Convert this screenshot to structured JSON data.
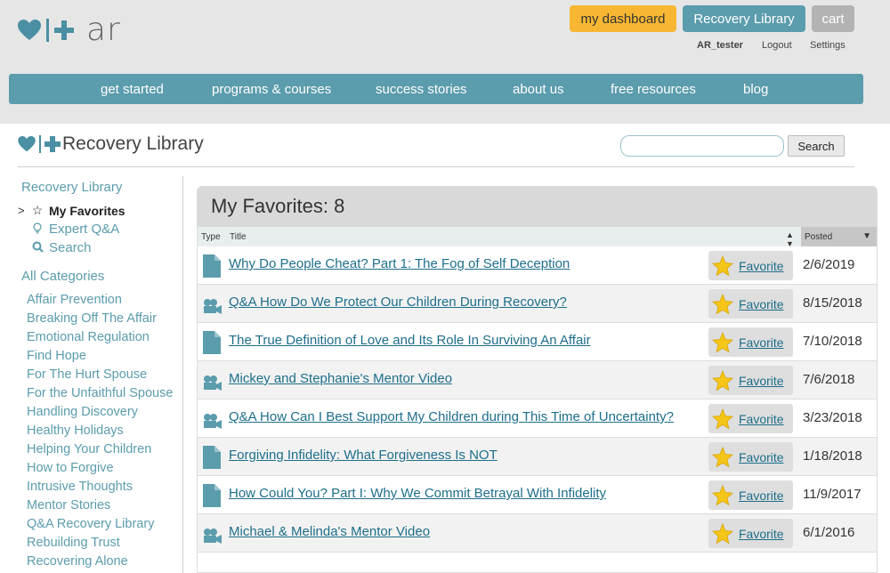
{
  "header": {
    "logo_text": "ar",
    "buttons": {
      "dashboard": "my dashboard",
      "library": "Recovery Library",
      "cart": "cart"
    },
    "user": {
      "name": "AR_tester",
      "logout": "Logout",
      "settings": "Settings"
    },
    "nav": [
      "get started",
      "programs & courses",
      "success stories",
      "about us",
      "free resources",
      "blog"
    ]
  },
  "library": {
    "title": "Recovery Library",
    "search": {
      "placeholder": "",
      "button": "Search"
    }
  },
  "sidebar": {
    "heading": "Recovery Library",
    "items": [
      {
        "label": "My Favorites",
        "icon": "star-icon",
        "active": true
      },
      {
        "label": "Expert Q&A",
        "icon": "lightbulb-icon",
        "active": false
      },
      {
        "label": "Search",
        "icon": "search-icon",
        "active": false
      }
    ],
    "categories_heading": "All Categories",
    "categories": [
      "Affair Prevention",
      "Breaking Off The Affair",
      "Emotional Regulation",
      "Find Hope",
      "For The Hurt Spouse",
      "For the Unfaithful Spouse",
      "Handling Discovery",
      "Healthy Holidays",
      "Helping Your Children",
      "How to Forgive",
      "Intrusive Thoughts",
      "Mentor Stories",
      "Q&A Recovery Library",
      "Rebuilding Trust",
      "Recovering Alone"
    ]
  },
  "favorites": {
    "heading": "My Favorites: 8",
    "columns": {
      "type": "Type",
      "title": "Title",
      "posted": "Posted"
    },
    "rows": [
      {
        "type": "document",
        "title": "Why Do People Cheat? Part 1: The Fog of Self Deception",
        "favorite": "Favorite",
        "posted": "2/6/2019"
      },
      {
        "type": "video",
        "title": "Q&A How Do We Protect Our Children During Recovery?",
        "favorite": "Favorite",
        "posted": "8/15/2018"
      },
      {
        "type": "document",
        "title": "The True Definition of Love and Its Role In Surviving An Affair",
        "favorite": "Favorite",
        "posted": "7/10/2018"
      },
      {
        "type": "video",
        "title": "Mickey and Stephanie's Mentor Video",
        "favorite": "Favorite",
        "posted": "7/6/2018"
      },
      {
        "type": "video",
        "title": "Q&A How Can I Best Support My Children during This Time of Uncertainty?",
        "favorite": "Favorite",
        "posted": "3/23/2018"
      },
      {
        "type": "document",
        "title": "Forgiving Infidelity: What Forgiveness Is NOT",
        "favorite": "Favorite",
        "posted": "1/18/2018"
      },
      {
        "type": "document",
        "title": "How Could You? Part I: Why We Commit Betrayal With Infidelity",
        "favorite": "Favorite",
        "posted": "11/9/2017"
      },
      {
        "type": "video",
        "title": "Michael & Melinda's Mentor Video",
        "favorite": "Favorite",
        "posted": "6/1/2016"
      }
    ]
  },
  "colors": {
    "brand_teal": "#5b9cad",
    "dashboard_yellow": "#f7b733",
    "link_blue": "#1d6e8a",
    "star_gold": "#f5c518"
  }
}
